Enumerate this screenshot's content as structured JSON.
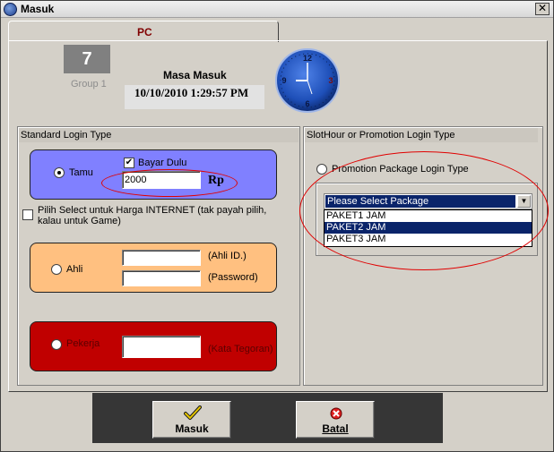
{
  "window": {
    "title": "Masuk",
    "close_glyph": "✕"
  },
  "tab": {
    "label": "PC"
  },
  "pc": {
    "number": "7",
    "group": "Group 1"
  },
  "masa_masuk": {
    "label": "Masa Masuk",
    "value": "10/10/2010 1:29:57 PM"
  },
  "clock": {
    "numerals": [
      "12",
      "3",
      "6",
      "9"
    ],
    "icon": "clock-icon"
  },
  "standard_login": {
    "header": "Standard Login Type",
    "tamu": {
      "label": "Tamu",
      "selected": true,
      "color": "#8080ff"
    },
    "bayar_dulu": {
      "label": "Bayar Dulu",
      "checked": true,
      "check_glyph": "✔"
    },
    "amount": {
      "value": "2000"
    },
    "currency": "Rp",
    "pilih_select": {
      "label": "Pilih Select untuk Harga INTERNET (tak payah pilih, kalau untuk Game)",
      "checked": false
    },
    "ahli": {
      "label": "Ahli",
      "selected": false,
      "id_label": "(Ahli ID.)",
      "password_label": "(Password)",
      "color": "#ffc080"
    },
    "pekerja": {
      "label": "Pekerja",
      "selected": false,
      "kata_label": "(Kata Tegoran)",
      "color": "#c00000"
    }
  },
  "promo_login": {
    "header": "SlotHour or Promotion Login Type",
    "option_label": "Promotion Package Login Type",
    "select": {
      "value": "Please Select Package",
      "arrow": "▼"
    },
    "options": [
      "PAKET1 JAM",
      "PAKET2 JAM",
      "PAKET3 JAM"
    ],
    "highlighted_index": 1
  },
  "buttons": {
    "masuk": {
      "label": "Masuk",
      "icon": "checkmark-icon"
    },
    "batal": {
      "label": "Batal",
      "icon": "cancel-icon"
    }
  },
  "colors": {
    "window_bg": "#d4d0c8",
    "selection": "#0a246a",
    "annotation": "#e00000"
  }
}
